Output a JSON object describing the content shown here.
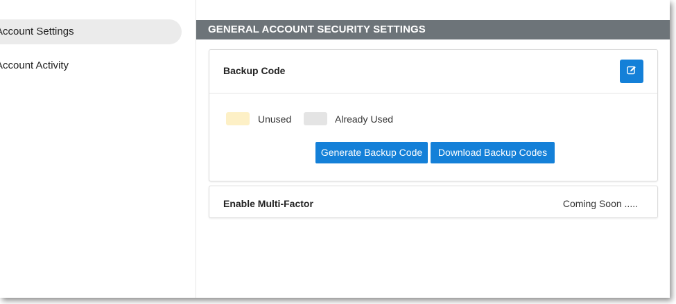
{
  "sidebar": {
    "items": [
      {
        "label": "Account Settings",
        "active": true
      },
      {
        "label": "Account Activity",
        "active": false
      }
    ]
  },
  "main": {
    "section_title": "GENERAL ACCOUNT SECURITY SETTINGS",
    "backup_card": {
      "title": "Backup Code",
      "edit_icon": "edit-icon",
      "legend": [
        {
          "label": "Unused",
          "color": "#fdf0c6"
        },
        {
          "label": "Already Used",
          "color": "#e4e4e4"
        }
      ],
      "generate_label": "Generate Backup Code",
      "download_label": "Download Backup Codes"
    },
    "multifactor_card": {
      "title": "Enable Multi-Factor",
      "status": "Coming Soon ....."
    }
  },
  "colors": {
    "accent": "#1480d8",
    "header_bg": "#6d7479"
  }
}
